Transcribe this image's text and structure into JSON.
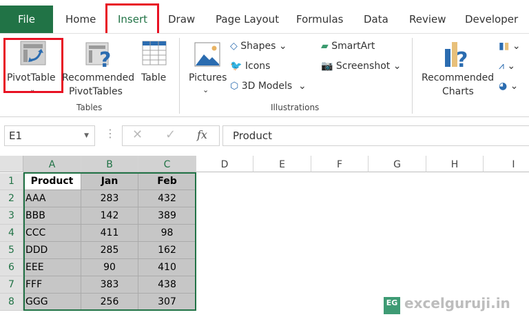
{
  "tabs": [
    {
      "label": "File"
    },
    {
      "label": "Home"
    },
    {
      "label": "Insert"
    },
    {
      "label": "Draw"
    },
    {
      "label": "Page Layout"
    },
    {
      "label": "Formulas"
    },
    {
      "label": "Data"
    },
    {
      "label": "Review"
    },
    {
      "label": "Developer"
    }
  ],
  "active_tab": "Insert",
  "ribbon": {
    "pivottable": "PivotTable",
    "rec_pivot_1": "Recommended",
    "rec_pivot_2": "PivotTables",
    "table": "Table",
    "tables_group": "Tables",
    "pictures": "Pictures",
    "shapes": "Shapes",
    "icons": "Icons",
    "models": "3D Models",
    "smartart": "SmartArt",
    "screenshot": "Screenshot",
    "illustrations_group": "Illustrations",
    "rec_charts_1": "Recommended",
    "rec_charts_2": "Charts"
  },
  "formula_bar": {
    "name_box": "E1",
    "fx": "fx",
    "content": "Product"
  },
  "columns": [
    "A",
    "B",
    "C",
    "D",
    "E",
    "F",
    "G",
    "H",
    "I"
  ],
  "rows": [
    "1",
    "2",
    "3",
    "4",
    "5",
    "6",
    "7",
    "8"
  ],
  "table": {
    "headers": [
      "Product",
      "Jan",
      "Feb"
    ],
    "rows": [
      [
        "AAA",
        "283",
        "432"
      ],
      [
        "BBB",
        "142",
        "389"
      ],
      [
        "CCC",
        "411",
        "98"
      ],
      [
        "DDD",
        "285",
        "162"
      ],
      [
        "EEE",
        "90",
        "410"
      ],
      [
        "FFF",
        "383",
        "438"
      ],
      [
        "GGG",
        "256",
        "307"
      ]
    ]
  },
  "watermark": {
    "logo": "EG",
    "text": "excelguruji.in"
  },
  "colors": {
    "excel_green": "#217346",
    "highlight_red": "#e81123",
    "selection_gray": "#c6c6c6"
  }
}
